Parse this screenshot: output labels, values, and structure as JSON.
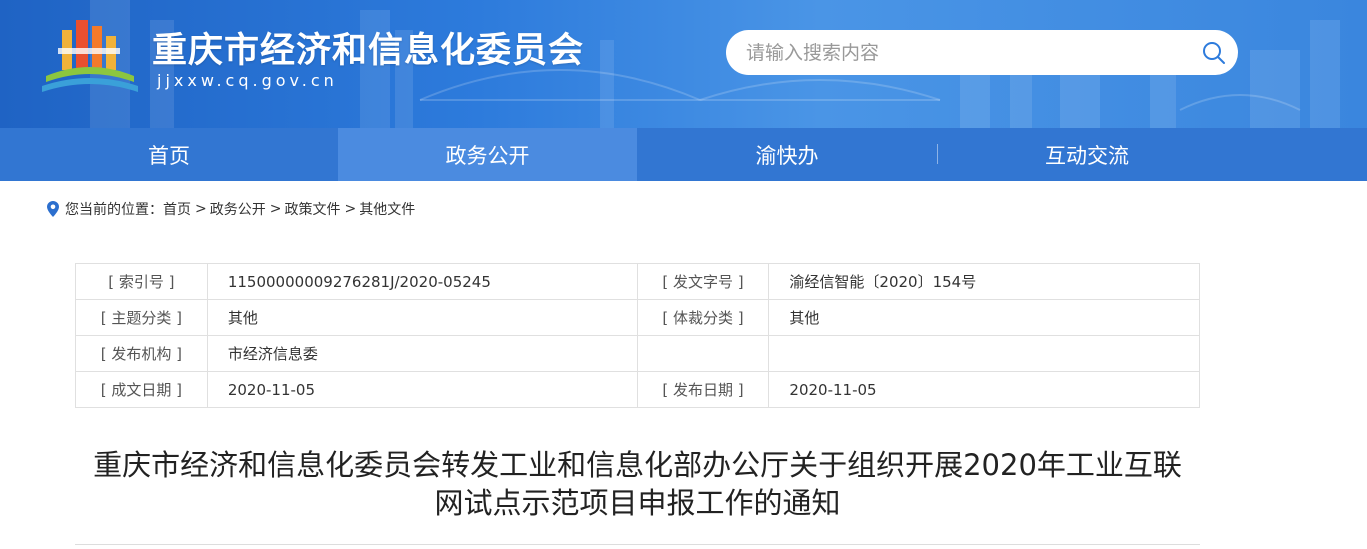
{
  "header": {
    "site_title": "重庆市经济和信息化委员会",
    "site_domain": "jjxxw.cq.gov.cn",
    "logo_icon": "chongqing-emblem-icon",
    "search": {
      "placeholder": "请输入搜索内容",
      "value": "",
      "icon": "search-icon"
    }
  },
  "nav": {
    "items": [
      {
        "label": "首页",
        "active": false
      },
      {
        "label": "政务公开",
        "active": true
      },
      {
        "label": "渝快办",
        "active": false
      },
      {
        "label": "互动交流",
        "active": false
      }
    ]
  },
  "breadcrumb": {
    "icon": "location-pin-icon",
    "prefix": "您当前的位置：",
    "items": [
      "首页",
      "政务公开",
      "政策文件",
      "其他文件"
    ],
    "separator": ">"
  },
  "meta": {
    "rows": [
      {
        "k1": "[ 索引号 ]",
        "v1": "11500000009276281J/2020-05245",
        "k2": "[ 发文字号 ]",
        "v2": "渝经信智能〔2020〕154号"
      },
      {
        "k1": "[ 主题分类 ]",
        "v1": "其他",
        "k2": "[ 体裁分类 ]",
        "v2": "其他"
      },
      {
        "k1": "[ 发布机构 ]",
        "v1": "市经济信息委",
        "k2": "",
        "v2": ""
      },
      {
        "k1": "[ 成文日期 ]",
        "v1": "2020-11-05",
        "k2": "[ 发布日期 ]",
        "v2": "2020-11-05"
      }
    ]
  },
  "article": {
    "title_line1": "重庆市经济和信息化委员会转发工业和信息化部办公厅关于组织开展2020年工业互联",
    "title_line2": "网试点示范项目申报工作的通知"
  },
  "colors": {
    "banner": "#2d7bdc",
    "nav": "#3276d2",
    "nav_active": "#4b8be0",
    "pin": "#2c6fce"
  }
}
